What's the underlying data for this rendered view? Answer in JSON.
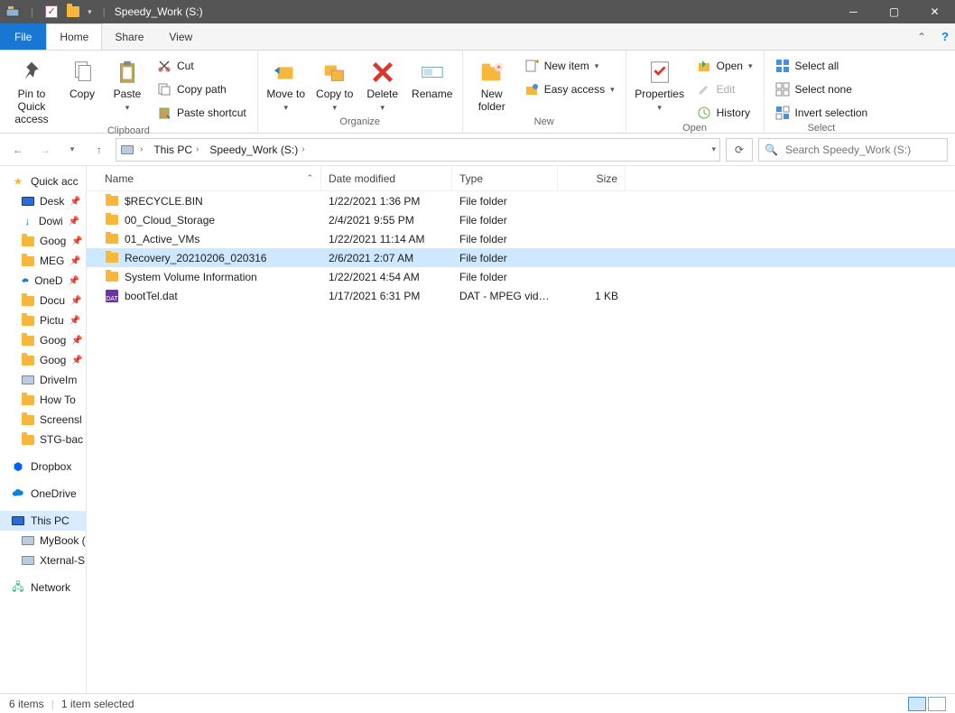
{
  "title": "Speedy_Work (S:)",
  "tabs": {
    "file": "File",
    "home": "Home",
    "share": "Share",
    "view": "View"
  },
  "ribbon": {
    "clipboard": {
      "label": "Clipboard",
      "pin": "Pin to Quick access",
      "copy": "Copy",
      "paste": "Paste",
      "cut": "Cut",
      "copypath": "Copy path",
      "pasteshortcut": "Paste shortcut"
    },
    "organize": {
      "label": "Organize",
      "moveto": "Move to",
      "copyto": "Copy to",
      "delete": "Delete",
      "rename": "Rename"
    },
    "new": {
      "label": "New",
      "newfolder": "New folder",
      "newitem": "New item",
      "easyaccess": "Easy access"
    },
    "open": {
      "label": "Open",
      "properties": "Properties",
      "open": "Open",
      "edit": "Edit",
      "history": "History"
    },
    "select": {
      "label": "Select",
      "selectall": "Select all",
      "selectnone": "Select none",
      "invert": "Invert selection"
    }
  },
  "breadcrumb": {
    "thispc": "This PC",
    "drive": "Speedy_Work (S:)"
  },
  "search_placeholder": "Search Speedy_Work (S:)",
  "columns": {
    "name": "Name",
    "date": "Date modified",
    "type": "Type",
    "size": "Size"
  },
  "rows": [
    {
      "name": "$RECYCLE.BIN",
      "date": "1/22/2021 1:36 PM",
      "type": "File folder",
      "size": "",
      "icon": "folder",
      "selected": false
    },
    {
      "name": "00_Cloud_Storage",
      "date": "2/4/2021 9:55 PM",
      "type": "File folder",
      "size": "",
      "icon": "folder",
      "selected": false
    },
    {
      "name": "01_Active_VMs",
      "date": "1/22/2021 11:14 AM",
      "type": "File folder",
      "size": "",
      "icon": "folder",
      "selected": false
    },
    {
      "name": "Recovery_20210206_020316",
      "date": "2/6/2021 2:07 AM",
      "type": "File folder",
      "size": "",
      "icon": "folder",
      "selected": true
    },
    {
      "name": "System Volume Information",
      "date": "1/22/2021 4:54 AM",
      "type": "File folder",
      "size": "",
      "icon": "folder",
      "selected": false
    },
    {
      "name": "bootTel.dat",
      "date": "1/17/2021 6:31 PM",
      "type": "DAT - MPEG video...",
      "size": "1 KB",
      "icon": "dat",
      "selected": false
    }
  ],
  "sidebar": {
    "quick": "Quick acc",
    "quick_items": [
      "Desk",
      "Dowi",
      "Goog",
      "MEG",
      "OneD",
      "Docu",
      "Pictu",
      "Goog",
      "Goog",
      "DriveIm",
      "How To",
      "Screensl",
      "STG-bac"
    ],
    "dropbox": "Dropbox",
    "onedrive": "OneDrive",
    "thispc": "This PC",
    "thispc_items": [
      "MyBook (",
      "Xternal-S"
    ],
    "network": "Network"
  },
  "status": {
    "items": "6 items",
    "selected": "1 item selected"
  }
}
